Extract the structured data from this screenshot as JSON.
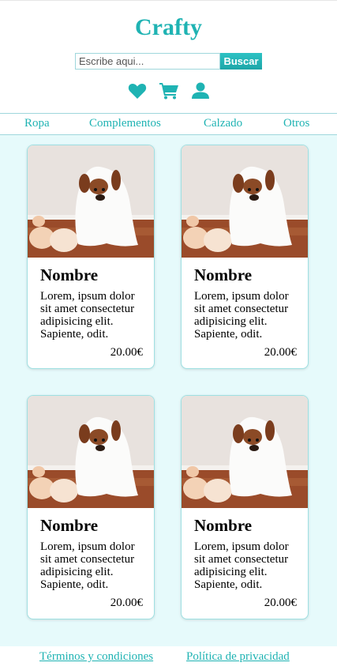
{
  "brand": "Crafty",
  "search": {
    "placeholder": "Escribe aqui...",
    "button": "Buscar"
  },
  "icons": [
    "heart-icon",
    "cart-icon",
    "user-icon"
  ],
  "accent_color": "#1fb3b3",
  "nav": [
    "Ropa",
    "Complementos",
    "Calzado",
    "Otros"
  ],
  "products": [
    {
      "name": "Nombre",
      "description": "Lorem, ipsum dolor sit amet consectetur adipisicing elit. Sapiente, odit.",
      "price": "20.00€"
    },
    {
      "name": "Nombre",
      "description": "Lorem, ipsum dolor sit amet consectetur adipisicing elit. Sapiente, odit.",
      "price": "20.00€"
    },
    {
      "name": "Nombre",
      "description": "Lorem, ipsum dolor sit amet consectetur adipisicing elit. Sapiente, odit.",
      "price": "20.00€"
    },
    {
      "name": "Nombre",
      "description": "Lorem, ipsum dolor sit amet consectetur adipisicing elit. Sapiente, odit.",
      "price": "20.00€"
    }
  ],
  "footer": {
    "terms": "Términos y condiciones",
    "privacy": "Política de privacidad"
  }
}
